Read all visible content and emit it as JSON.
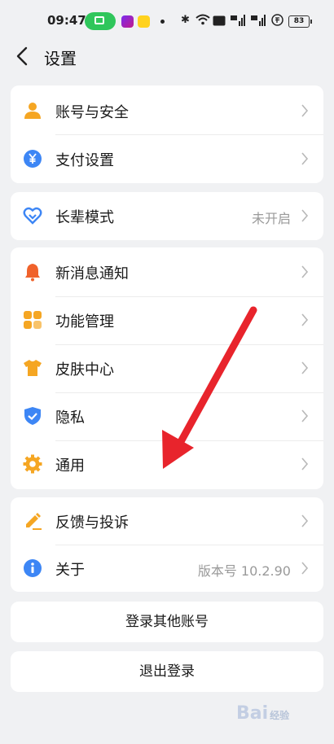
{
  "status_bar": {
    "time": "09:47",
    "battery": "83",
    "right_icons": [
      "bluetooth-icon",
      "wifi-icon",
      "hd-icon",
      "signal-icon",
      "signal-icon",
      "rupee-icon",
      "battery-icon"
    ]
  },
  "header": {
    "title": "设置",
    "back_icon": "chevron-left-icon"
  },
  "groups": [
    [
      {
        "label": "账号与安全",
        "icon": "user-icon",
        "color": "#f5a623"
      },
      {
        "label": "支付设置",
        "icon": "yen-coin-icon",
        "color": "#3d86f5"
      }
    ],
    [
      {
        "label": "长辈模式",
        "icon": "heart-elder-icon",
        "color": "#3d86f5",
        "value": "未开启"
      }
    ],
    [
      {
        "label": "新消息通知",
        "icon": "bell-icon",
        "color": "#f0622b"
      },
      {
        "label": "功能管理",
        "icon": "apps-grid-icon",
        "color": "#f5a623"
      },
      {
        "label": "皮肤中心",
        "icon": "tshirt-icon",
        "color": "#f5a623"
      },
      {
        "label": "隐私",
        "icon": "shield-check-icon",
        "color": "#3d86f5"
      },
      {
        "label": "通用",
        "icon": "gear-icon",
        "color": "#f5a623"
      }
    ],
    [
      {
        "label": "反馈与投诉",
        "icon": "pencil-icon",
        "color": "#f5a623"
      },
      {
        "label": "关于",
        "icon": "info-icon",
        "color": "#3d86f5",
        "value": "版本号 10.2.90"
      }
    ]
  ],
  "buttons": {
    "switch_account": "登录其他账号",
    "logout": "退出登录"
  },
  "watermark": {
    "text": "Bai",
    "sub": "经验"
  },
  "annotation": {
    "arrow_color": "#e8242c"
  }
}
